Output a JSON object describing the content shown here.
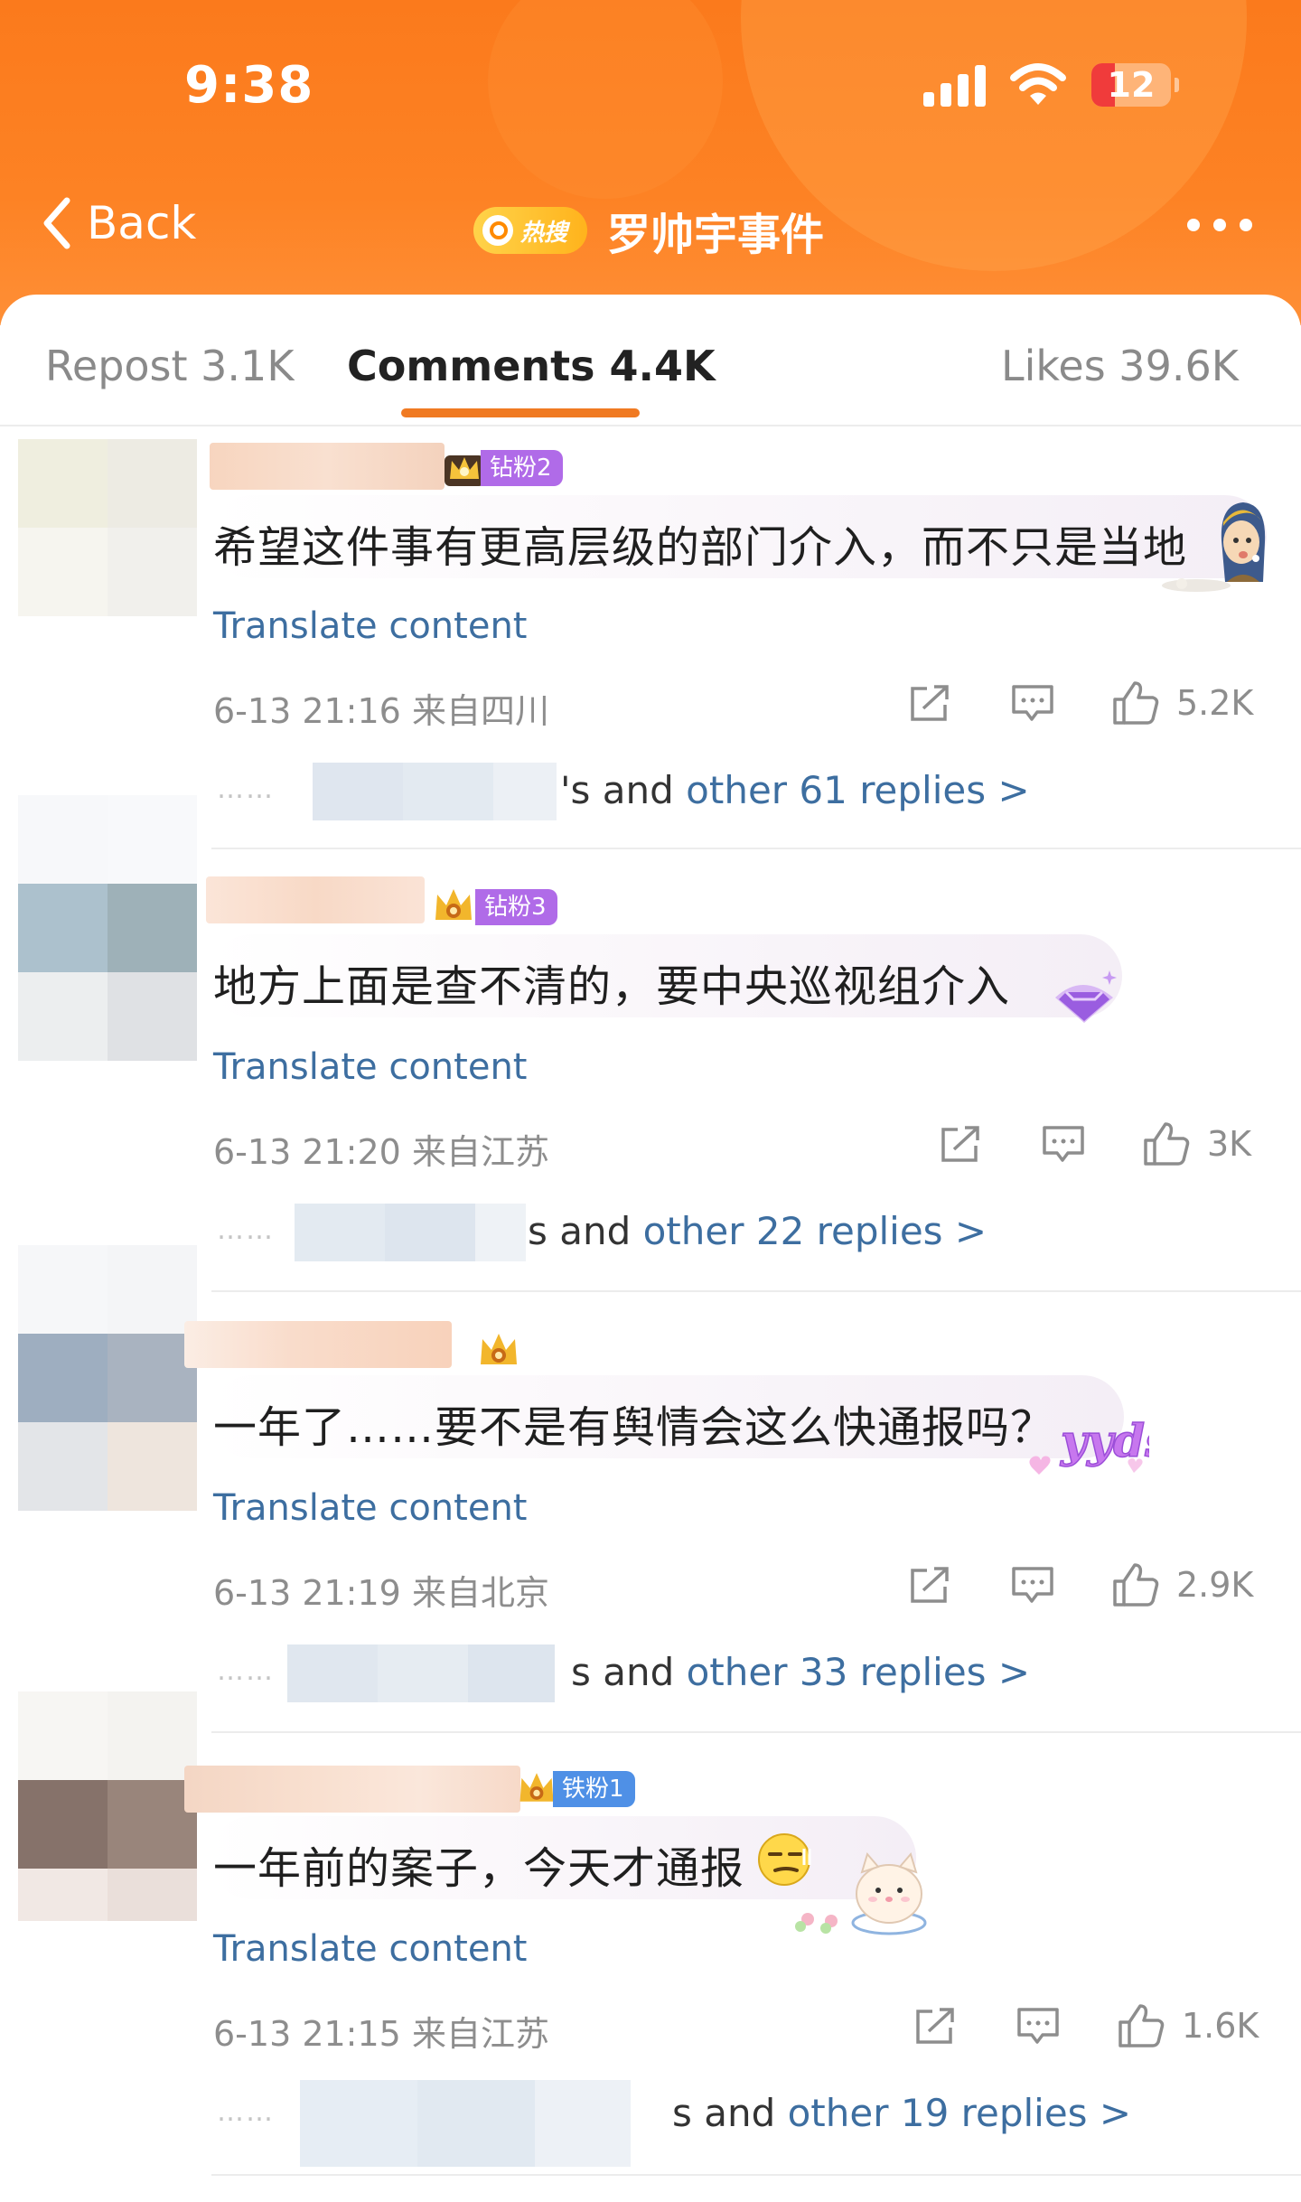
{
  "status_bar": {
    "time": "9:38",
    "battery": "12"
  },
  "nav": {
    "back_label": "Back",
    "hot_badge": "热搜",
    "title": "罗帅宇事件"
  },
  "tabs": [
    {
      "label": "Repost 3.1K"
    },
    {
      "label": "Comments 4.4K",
      "active": true
    },
    {
      "label": "Likes 39.6K"
    }
  ],
  "translate_label": "Translate content",
  "comments": [
    {
      "level": "钻粉2",
      "text": "希望这件事有更高层级的部门介入，而不只是当地",
      "time": "6-13 21:16",
      "location": "来自四川",
      "likes": "5.2K",
      "reply_prefix": "'s and ",
      "reply_link": "other 61 replies >"
    },
    {
      "level": "钻粉3",
      "text": "地方上面是查不清的，要中央巡视组介入",
      "time": "6-13 21:20",
      "location": "来自江苏",
      "likes": "3K",
      "reply_prefix": "s and ",
      "reply_link": "other 22 replies >"
    },
    {
      "level": "",
      "text": "一年了……要不是有舆情会这么快通报吗？",
      "time": "6-13 21:19",
      "location": "来自北京",
      "likes": "2.9K",
      "reply_prefix": "s and ",
      "reply_link": "other 33 replies >"
    },
    {
      "level": "铁粉1",
      "text": "一年前的案子，今天才通报",
      "time": "6-13 21:15",
      "location": "来自江苏",
      "likes": "1.6K",
      "reply_prefix": "s and ",
      "reply_link": "other 19 replies >"
    }
  ],
  "reply_dots": "……",
  "colors": {
    "header": "#fd8224",
    "link": "#3d6ea0",
    "tab_underline": "#f07a22",
    "level_badge": "#b06be8"
  }
}
